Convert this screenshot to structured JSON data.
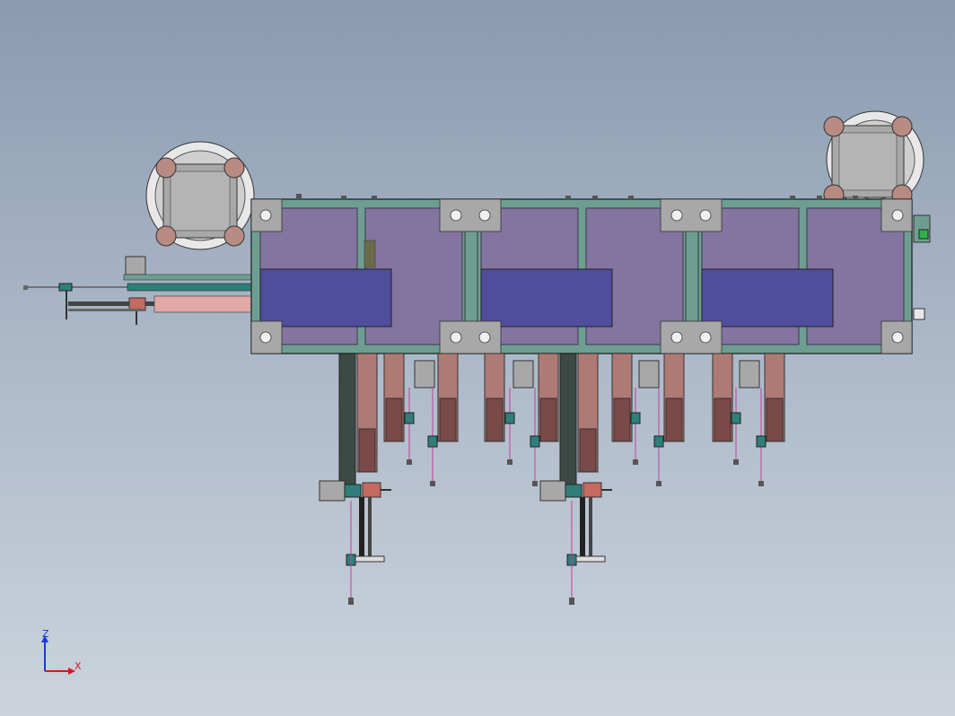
{
  "viewport": {
    "background_top": "#8a9ab0",
    "background_bottom": "#ccd3dc"
  },
  "model": {
    "frame_color": "#6e9e92",
    "panel_color": "#8474a0",
    "plate_color": "#4f4d9c",
    "drum_color": "#a8a8a8",
    "roller_color": "#b78a82",
    "spring_color": "#c040a0",
    "bracket_color": "#7a4a48"
  },
  "triad": {
    "z_label": "Z",
    "x_label": "X",
    "z_color": "#1a3bd6",
    "x_color": "#d61a1a"
  }
}
